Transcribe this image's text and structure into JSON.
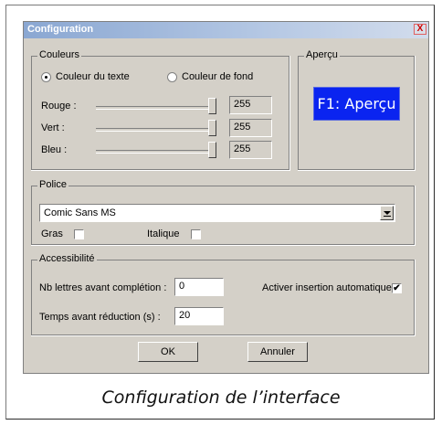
{
  "window": {
    "title": "Configuration",
    "close_glyph": "X"
  },
  "couleurs": {
    "legend": "Couleurs",
    "radio_text": "Couleur du texte",
    "radio_fond": "Couleur de fond",
    "selected": "Couleur du texte",
    "rows": [
      {
        "label": "Rouge :",
        "value": "255"
      },
      {
        "label": "Vert :",
        "value": "255"
      },
      {
        "label": "Bleu :",
        "value": "255"
      }
    ]
  },
  "apercu": {
    "legend": "Aperçu",
    "preview_text": "F1: Aperçu",
    "preview_bg": "#0a24f0",
    "preview_fg": "#ffffff"
  },
  "police": {
    "legend": "Police",
    "font_selected": "Comic Sans MS",
    "gras_label": "Gras",
    "gras_checked": false,
    "italique_label": "Italique",
    "italique_checked": false
  },
  "accessibilite": {
    "legend": "Accessibilité",
    "nb_lettres_label": "Nb lettres avant complétion :",
    "nb_lettres_value": "0",
    "temps_label": "Temps avant réduction (s) :",
    "temps_value": "20",
    "auto_insert_label": "Activer insertion automatique",
    "auto_insert_checked": true,
    "check_glyph": "✔"
  },
  "buttons": {
    "ok": "OK",
    "annuler": "Annuler"
  },
  "caption": "Configuration de l’interface"
}
